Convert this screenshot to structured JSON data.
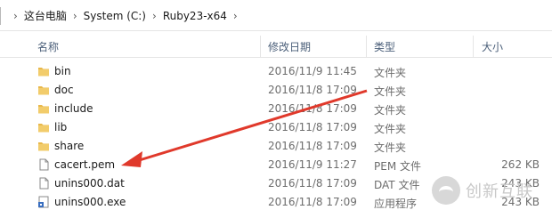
{
  "breadcrumb": {
    "items": [
      "这台电脑",
      "System (C:)",
      "Ruby23-x64"
    ]
  },
  "columns": {
    "name": "名称",
    "date": "修改日期",
    "type": "类型",
    "size": "大小"
  },
  "files": [
    {
      "name": "bin",
      "date": "2016/11/9 11:45",
      "type": "文件夹",
      "size": "",
      "icon": "folder-icon"
    },
    {
      "name": "doc",
      "date": "2016/11/8 17:09",
      "type": "文件夹",
      "size": "",
      "icon": "folder-icon"
    },
    {
      "name": "include",
      "date": "2016/11/8 17:09",
      "type": "文件夹",
      "size": "",
      "icon": "folder-icon"
    },
    {
      "name": "lib",
      "date": "2016/11/8 17:09",
      "type": "文件夹",
      "size": "",
      "icon": "folder-icon"
    },
    {
      "name": "share",
      "date": "2016/11/8 17:09",
      "type": "文件夹",
      "size": "",
      "icon": "folder-icon"
    },
    {
      "name": "cacert.pem",
      "date": "2016/11/9 11:27",
      "type": "PEM 文件",
      "size": "262 KB",
      "icon": "file-icon"
    },
    {
      "name": "unins000.dat",
      "date": "2016/11/8 17:09",
      "type": "DAT 文件",
      "size": "243 KB",
      "icon": "file-icon"
    },
    {
      "name": "unins000.exe",
      "date": "2016/11/8 17:09",
      "type": "应用程序",
      "size": "243 KB",
      "icon": "exe-icon"
    }
  ],
  "watermark": "创新互联",
  "colors": {
    "folder": "#e8b84b",
    "arrow": "#e0392b",
    "header_text": "#4c607a"
  }
}
